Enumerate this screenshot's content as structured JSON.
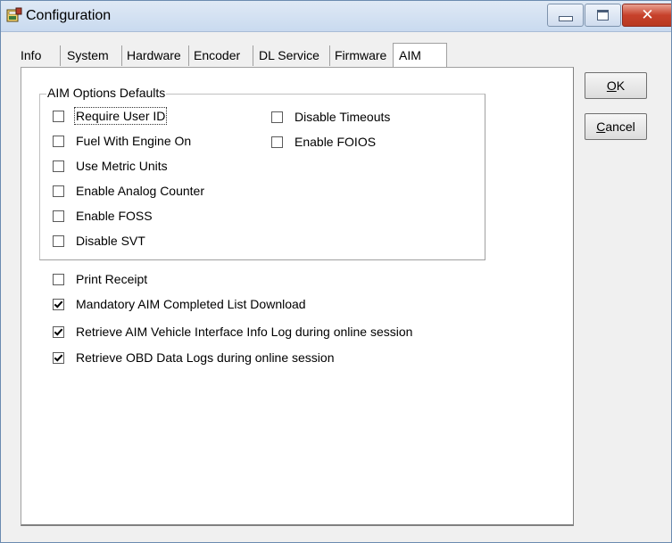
{
  "window": {
    "title": "Configuration",
    "controls": {
      "minimize_icon": "minimize-icon",
      "maximize_icon": "maximize-icon",
      "close_icon": "close-icon",
      "close_glyph": "✕"
    }
  },
  "tabs": [
    {
      "label": "Info",
      "active": false
    },
    {
      "label": "System",
      "active": false
    },
    {
      "label": "Hardware",
      "active": false
    },
    {
      "label": "Encoder",
      "active": false
    },
    {
      "label": "DL Service",
      "active": false
    },
    {
      "label": "Firmware",
      "active": false
    },
    {
      "label": "AIM",
      "active": true
    }
  ],
  "aim_options": {
    "group_title": "AIM Options Defaults",
    "left_column": [
      {
        "label": "Require User ID",
        "checked": false
      },
      {
        "label": "Fuel With Engine On",
        "checked": false
      },
      {
        "label": "Use Metric Units",
        "checked": false
      },
      {
        "label": "Enable Analog Counter",
        "checked": false
      },
      {
        "label": "Enable FOSS",
        "checked": false
      },
      {
        "label": "Disable SVT",
        "checked": false
      }
    ],
    "right_column": [
      {
        "label": "Disable Timeouts",
        "checked": false
      },
      {
        "label": "Enable FOIOS",
        "checked": false
      }
    ]
  },
  "other_options": [
    {
      "label": "Print Receipt",
      "checked": false
    },
    {
      "label": "Mandatory AIM Completed List Download",
      "checked": true
    },
    {
      "label": "Retrieve AIM Vehicle Interface Info Log during online session",
      "checked": true
    },
    {
      "label": "Retrieve OBD Data Logs during online session",
      "checked": true
    }
  ],
  "buttons": {
    "ok": {
      "mnemonic": "O",
      "rest": "K"
    },
    "cancel": {
      "mnemonic": "C",
      "rest": "ancel"
    }
  }
}
